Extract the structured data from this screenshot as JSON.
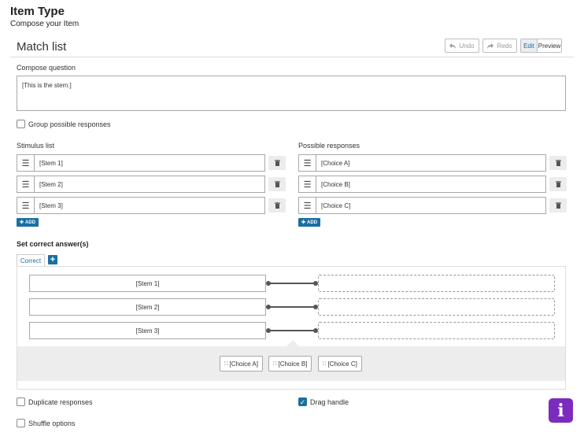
{
  "header": {
    "title": "Item Type",
    "subtitle": "Compose your Item"
  },
  "card": {
    "title": "Match list"
  },
  "toolbar": {
    "undo": "Undo",
    "redo": "Redo",
    "edit": "Edit",
    "preview": "Preview"
  },
  "compose": {
    "label": "Compose question",
    "value": "[This is the stem.]"
  },
  "group_responses": {
    "label": "Group possible responses",
    "checked": false
  },
  "stimulus": {
    "label": "Stimulus list",
    "items": [
      "[Stem 1]",
      "[Stem 2]",
      "[Stem 3]"
    ],
    "add": "ADD"
  },
  "responses": {
    "label": "Possible responses",
    "items": [
      "[Choice A]",
      "[Choice B]",
      "[Choice C]"
    ],
    "add": "ADD"
  },
  "answer": {
    "title": "Set correct answer(s)",
    "tab": "Correct",
    "tab_add": "+",
    "stems": [
      "[Stem 1]",
      "[Stem 2]",
      "[Stem 3]"
    ],
    "choices": [
      "[Choice A]",
      "[Choice B]",
      "[Choice C]"
    ]
  },
  "options": {
    "duplicate": {
      "label": "Duplicate responses",
      "checked": false
    },
    "drag_handle": {
      "label": "Drag handle",
      "checked": true
    },
    "shuffle": {
      "label": "Shuffle options",
      "checked": false
    }
  },
  "badge": {
    "glyph": "i"
  },
  "colors": {
    "accent": "#1b6fa0",
    "badge": "#7b2cbf"
  }
}
